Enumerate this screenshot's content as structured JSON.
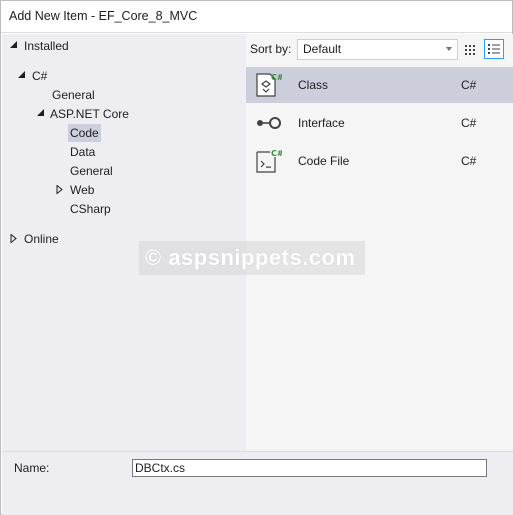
{
  "window": {
    "title": "Add New Item - EF_Core_8_MVC"
  },
  "tree": {
    "installed": "Installed",
    "csharp": "C#",
    "general": "General",
    "aspnet_core": "ASP.NET Core",
    "code": "Code",
    "data": "Data",
    "aspnet_general": "General",
    "web": "Web",
    "csharp_sub": "CSharp",
    "online": "Online"
  },
  "sort": {
    "label": "Sort by:",
    "value": "Default"
  },
  "templates": [
    {
      "name": "Class",
      "lang": "C#",
      "icon": "class-icon"
    },
    {
      "name": "Interface",
      "lang": "C#",
      "icon": "interface-icon"
    },
    {
      "name": "Code File",
      "lang": "C#",
      "icon": "code-file-icon"
    }
  ],
  "name_field": {
    "label": "Name:",
    "value": "DBCtx.cs"
  },
  "watermark": {
    "text": "© aspsnippets.com"
  },
  "colors": {
    "accent": "#3399ff",
    "selection": "#cccedb",
    "csharp_badge": "#388a34"
  }
}
